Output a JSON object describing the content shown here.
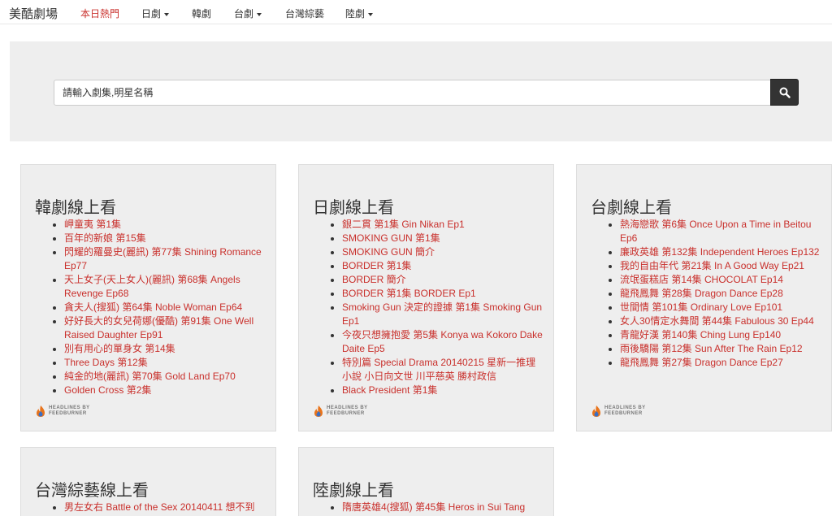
{
  "navbar": {
    "brand": "美酷劇場",
    "items": [
      {
        "label": "本日熱門",
        "active": true,
        "dropdown": false
      },
      {
        "label": "日劇",
        "active": false,
        "dropdown": true
      },
      {
        "label": "韓劇",
        "active": false,
        "dropdown": false
      },
      {
        "label": "台劇",
        "active": false,
        "dropdown": true
      },
      {
        "label": "台灣綜藝",
        "active": false,
        "dropdown": false
      },
      {
        "label": "陸劇",
        "active": false,
        "dropdown": true
      }
    ]
  },
  "search": {
    "placeholder": "請輸入劇集,明星名稱",
    "icon": "search-icon"
  },
  "feed_badge": {
    "line1": "HEADLINES BY",
    "line2": "FEEDBURNER"
  },
  "panels": [
    {
      "title": "韓劇線上看",
      "items": [
        "岬童夷 第1集",
        "百年的新娘 第15集",
        "閃耀的羅曼史(麗訊) 第77集 Shining Romance Ep77",
        "天上女子(天上女人)(麗訊) 第68集 Angels Revenge Ep68",
        "貪夫人(搜狐) 第64集 Noble Woman Ep64",
        "好好長大的女兒荷娜(優酷) 第91集 One Well Raised Daughter Ep91",
        "別有用心的單身女 第14集",
        "Three Days 第12集",
        "純金的地(麗訊) 第70集 Gold Land Ep70",
        "Golden Cross 第2集"
      ]
    },
    {
      "title": "日劇線上看",
      "items": [
        "銀二貫 第1集 Gin Nikan Ep1",
        "SMOKING GUN 第1集",
        "SMOKING GUN 簡介",
        "BORDER 第1集",
        "BORDER 簡介",
        "BORDER 第1集 BORDER Ep1",
        "Smoking Gun 決定的證據 第1集 Smoking Gun Ep1",
        "今夜只想擁抱愛 第5集 Konya wa Kokoro Dake Daite Ep5",
        "特別篇 Special Drama 20140215 星新一推理小說 小日向文世 川平慈英 勝村政信",
        "Black President 第1集"
      ]
    },
    {
      "title": "台劇線上看",
      "items": [
        "熱海戀歌 第6集 Once Upon a Time in Beitou Ep6",
        "廉政英雄 第132集 Independent Heroes Ep132",
        "我的自由年代 第21集 In A Good Way Ep21",
        "流氓蛋糕店 第14集 CHOCOLAT Ep14",
        "龍飛鳳舞 第28集 Dragon Dance Ep28",
        "世間情 第101集 Ordinary Love Ep101",
        "女人30情定水舞間 第44集 Fabulous 30 Ep44",
        "青龍好漢 第140集 Ching Lung Ep140",
        "雨後驕陽 第12集 Sun After The Rain Ep12",
        "龍飛鳳舞 第27集 Dragon Dance Ep27"
      ]
    },
    {
      "title": "台灣綜藝線上看",
      "items": [
        "男左女右 Battle of the Sex 20140411 想不到"
      ]
    },
    {
      "title": "陸劇線上看",
      "items": [
        "隋唐英雄4(搜狐) 第45集 Heros in Sui Tang"
      ]
    }
  ],
  "colors": {
    "link": "#c9302c",
    "panel_bg": "#eeeeee",
    "search_button": "#333333"
  }
}
